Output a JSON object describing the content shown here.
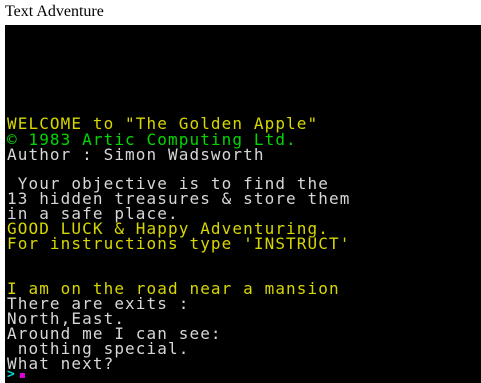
{
  "window": {
    "title": "Text Adventure"
  },
  "screen": {
    "welcome": "WELCOME to \"The Golden Apple\"",
    "copyright": "© 1983 Artic Computing Ltd.",
    "author": "Author : Simon Wadsworth",
    "objective_1": " Your objective is to find the",
    "objective_2": "13 hidden treasures & store them",
    "objective_3": "in a safe place.",
    "good_luck": "GOOD LUCK & Happy Adventuring.",
    "instructions": "For instructions type 'INSTRUCT'",
    "location": "I am on the road near a mansion",
    "exits_label": "There are exits :",
    "exits": "North,East.",
    "see_label": "Around me I can see:",
    "see_items": " nothing special.",
    "prompt": "What next?",
    "prompt_glyph": ">"
  },
  "colors": {
    "background": "#000000",
    "highlight_text": "#d7d700",
    "copyright_text": "#00d700",
    "normal_text": "#d7d7d7",
    "prompt_glyph": "#00d7d7",
    "cursor": "#d700d7"
  }
}
